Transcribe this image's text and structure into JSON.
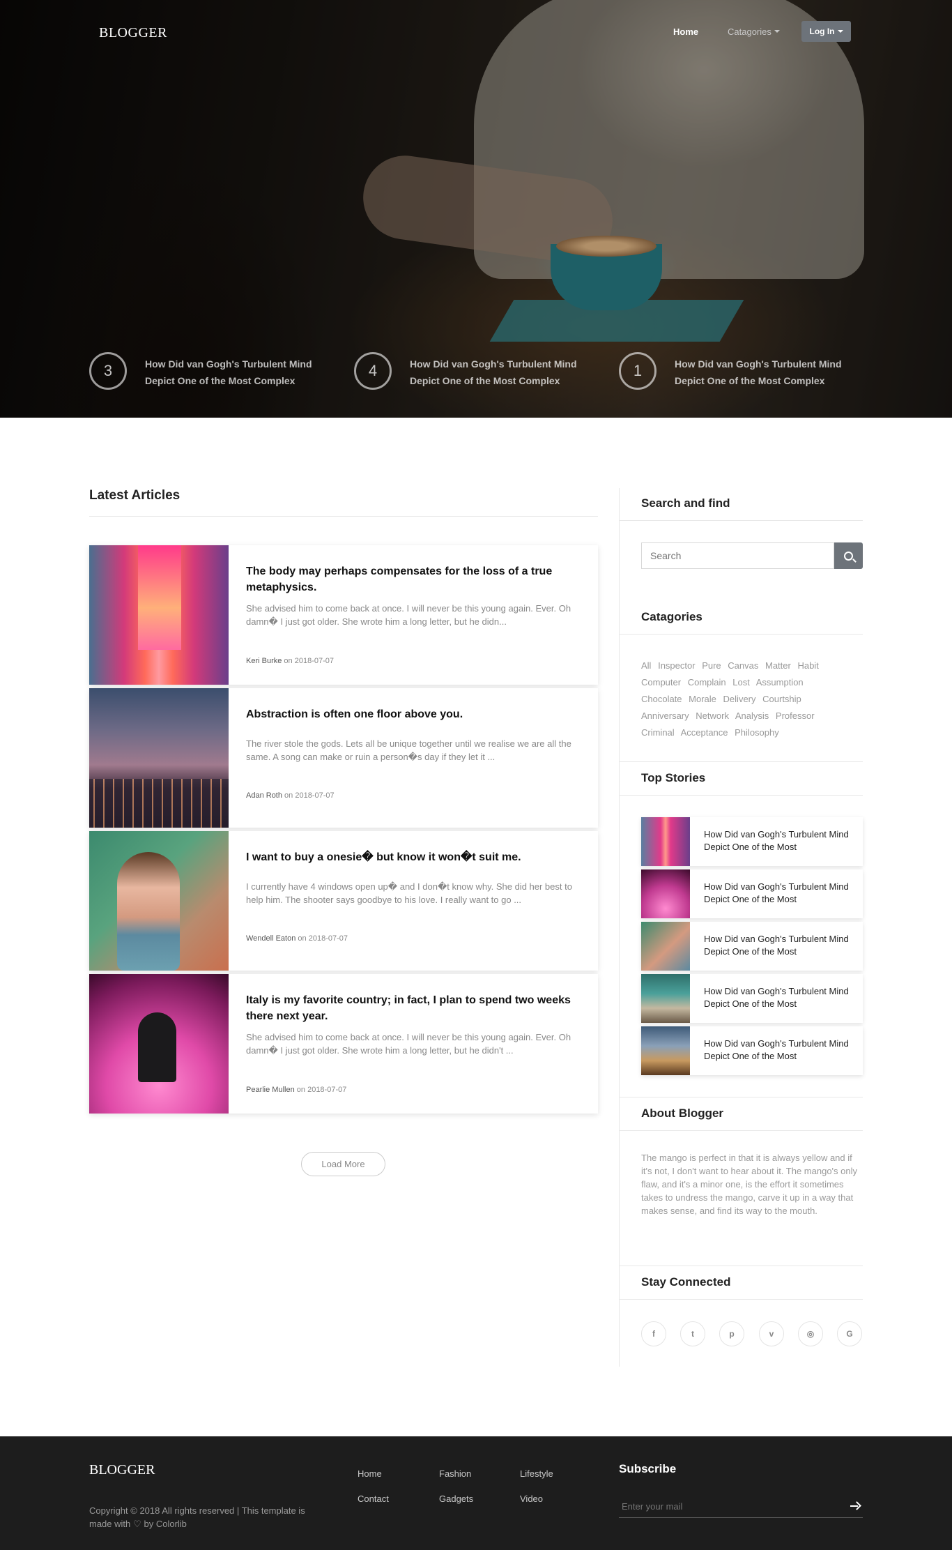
{
  "nav": {
    "brand": "BLOGGER",
    "home": "Home",
    "categories": "Catagories",
    "login": "Log In"
  },
  "hero_stories": [
    {
      "number": "3",
      "title": "How Did van Gogh's Turbulent Mind Depict One of the Most Complex"
    },
    {
      "number": "4",
      "title": "How Did van Gogh's Turbulent Mind Depict One of the Most Complex"
    },
    {
      "number": "1",
      "title": "How Did van Gogh's Turbulent Mind Depict One of the Most Complex"
    }
  ],
  "latest": {
    "heading": "Latest Articles",
    "articles": [
      {
        "title": "The body may perhaps compensates for the loss of a true metaphysics.",
        "excerpt": "She advised him to come back at once. I will never be this young again. Ever. Oh damn� I just got older. She wrote him a long letter, but he didn...",
        "author": "Keri Burke",
        "on": "on",
        "date": "2018-07-07"
      },
      {
        "title": "Abstraction is often one floor above you.",
        "excerpt": "The river stole the gods. Lets all be unique together until we realise we are all the same. A song can make or ruin a person�s day if they let it ...",
        "author": "Adan Roth",
        "on": "on",
        "date": "2018-07-07"
      },
      {
        "title": "I want to buy a onesie� but know it won�t suit me.",
        "excerpt": "I currently have 4 windows open up� and I don�t know why. She did her best to help him. The shooter says goodbye to his love. I really want to go ...",
        "author": "Wendell Eaton",
        "on": "on",
        "date": "2018-07-07"
      },
      {
        "title": "Italy is my favorite country; in fact, I plan to spend two weeks there next year.",
        "excerpt": "She advised him to come back at once. I will never be this young again. Ever. Oh damn� I just got older. She wrote him a long letter, but he didn't ...",
        "author": "Pearlie Mullen",
        "on": "on",
        "date": "2018-07-07"
      }
    ],
    "load_more": "Load More"
  },
  "sidebar": {
    "search_title": "Search and find",
    "search_placeholder": "Search",
    "categories_title": "Catagories",
    "tags": [
      "All",
      "Inspector",
      "Pure",
      "Canvas",
      "Matter",
      "Habit",
      "Computer",
      "Complain",
      "Lost",
      "Assumption",
      "Chocolate",
      "Morale",
      "Delivery",
      "Courtship",
      "Anniversary",
      "Network",
      "Analysis",
      "Professor",
      "Criminal",
      "Acceptance",
      "Philosophy"
    ],
    "top_stories_title": "Top Stories",
    "top_stories": [
      "How Did van Gogh's Turbulent Mind Depict One of the Most",
      "How Did van Gogh's Turbulent Mind Depict One of the Most",
      "How Did van Gogh's Turbulent Mind Depict One of the Most",
      "How Did van Gogh's Turbulent Mind Depict One of the Most",
      "How Did van Gogh's Turbulent Mind Depict One of the Most"
    ],
    "about_title": "About Blogger",
    "about_text": "The mango is perfect in that it is always yellow and if it's not, I don't want to hear about it. The mango's only flaw, and it's a minor one, is the effort it sometimes takes to undress the mango, carve it up in a way that makes sense, and find its way to the mouth.",
    "stay_title": "Stay Connected",
    "social": [
      {
        "icon": "facebook-icon",
        "glyph": "f"
      },
      {
        "icon": "twitter-icon",
        "glyph": "t"
      },
      {
        "icon": "pinterest-icon",
        "glyph": "p"
      },
      {
        "icon": "vimeo-icon",
        "glyph": "v"
      },
      {
        "icon": "instagram-icon",
        "glyph": "◎"
      },
      {
        "icon": "google-icon",
        "glyph": "G"
      }
    ]
  },
  "footer": {
    "brand": "BLOGGER",
    "copyright_pre": "Copyright © 2018 All rights reserved | This template is made with",
    "copyright_post": "by Colorlib",
    "links": [
      "Home",
      "Fashion",
      "Lifestyle",
      "Contact",
      "Gadgets",
      "Video"
    ],
    "subscribe_title": "Subscribe",
    "mail_placeholder": "Enter your mail"
  }
}
